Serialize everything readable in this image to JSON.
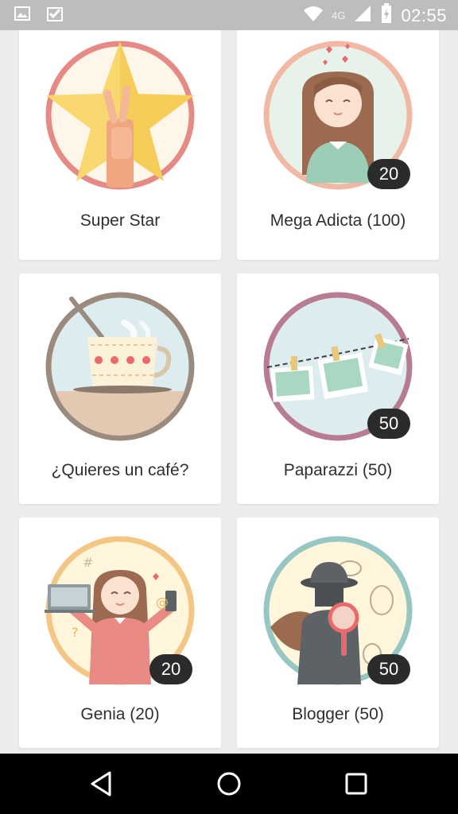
{
  "status_bar": {
    "time": "02:55",
    "network": "4G",
    "icons": [
      "image-icon",
      "check-app-icon",
      "wifi-icon",
      "signal-icon",
      "battery-charging-icon"
    ]
  },
  "badges": [
    {
      "label": "Super Star",
      "count": "",
      "ring_color": "#e58a84",
      "icon": "super-star-illustration"
    },
    {
      "label": "Mega Adicta (100)",
      "count": "20",
      "ring_color": "#f1b8a4",
      "icon": "girl-hearts-illustration"
    },
    {
      "label": "¿Quieres un café?",
      "count": "",
      "ring_color": "#9b8b7e",
      "icon": "coffee-cup-illustration"
    },
    {
      "label": "Paparazzi (50)",
      "count": "50",
      "ring_color": "#b77c92",
      "icon": "photos-line-illustration"
    },
    {
      "label": "Genia (20)",
      "count": "20",
      "ring_color": "#f3c783",
      "icon": "girl-devices-illustration"
    },
    {
      "label": "Blogger (50)",
      "count": "50",
      "ring_color": "#97c7c3",
      "icon": "detective-illustration"
    }
  ],
  "nav": {
    "back": "back-icon",
    "home": "home-icon",
    "recents": "recents-icon"
  }
}
